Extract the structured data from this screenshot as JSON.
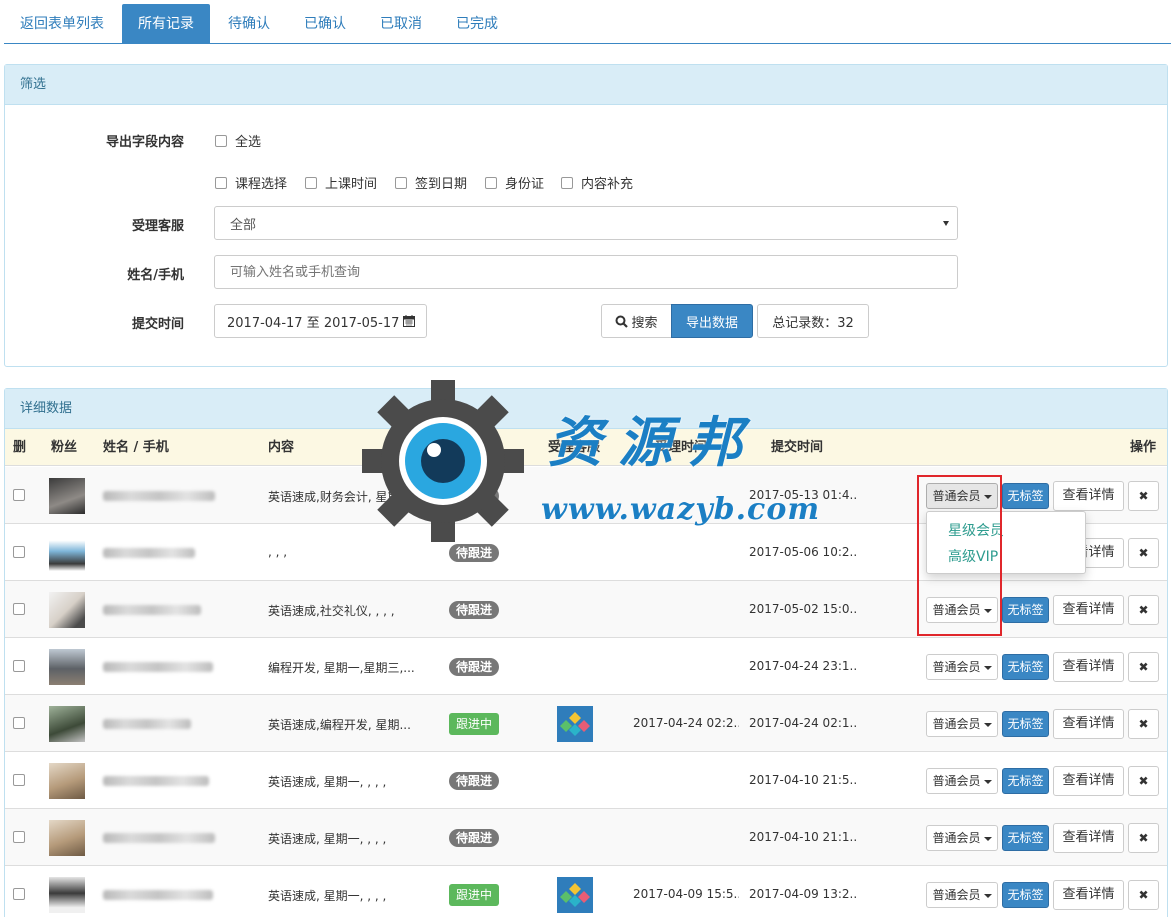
{
  "tabs": [
    "返回表单列表",
    "所有记录",
    "待确认",
    "已确认",
    "已取消",
    "已完成"
  ],
  "filter": {
    "title": "筛选",
    "export_label": "导出字段内容",
    "select_all": "全选",
    "fields": [
      "课程选择",
      "上课时间",
      "签到日期",
      "身份证",
      "内容补充"
    ],
    "service_label": "受理客服",
    "service_value": "全部",
    "name_label": "姓名/手机",
    "name_placeholder": "可输入姓名或手机查询",
    "time_label": "提交时间",
    "time_value": "2017-04-17 至 2017-05-17",
    "search_btn": "搜索",
    "export_btn": "导出数据",
    "total": "总记录数：32"
  },
  "detail": {
    "title": "详细数据",
    "headers": [
      "删",
      "粉丝",
      "姓名 / 手机",
      "内容",
      "状态",
      "受理客服",
      "受理时间",
      "提交时间",
      "操作"
    ],
    "rows": [
      {
        "content": "英语速成,财务会计, 星期",
        "status": "待跟进",
        "status_type": "gray",
        "accept_time": "",
        "submit_time": "2017-05-13 01:4...",
        "member": "普通会员",
        "tag": "无标签",
        "detail": "查看详情",
        "del": "✖"
      },
      {
        "content": ", , ,",
        "status": "待跟进",
        "status_type": "gray",
        "accept_time": "",
        "submit_time": "2017-05-06 10:2...",
        "member": "普通会员",
        "tag": "无标签",
        "detail": "查看详情",
        "del": "✖"
      },
      {
        "content": "英语速成,社交礼仪, , , ,",
        "status": "待跟进",
        "status_type": "gray",
        "accept_time": "",
        "submit_time": "2017-05-02 15:0...",
        "member": "普通会员",
        "tag": "无标签",
        "detail": "查看详情",
        "del": "✖"
      },
      {
        "content": "编程开发, 星期一,星期三,...",
        "status": "待跟进",
        "status_type": "gray",
        "accept_time": "",
        "submit_time": "2017-04-24 23:1...",
        "member": "普通会员",
        "tag": "无标签",
        "detail": "查看详情",
        "del": "✖"
      },
      {
        "content": "英语速成,编程开发, 星期...",
        "status": "跟进中",
        "status_type": "green",
        "accept_time": "2017-04-24 02:2...",
        "submit_time": "2017-04-24 02:1...",
        "member": "普通会员",
        "tag": "无标签",
        "detail": "查看详情",
        "del": "✖"
      },
      {
        "content": "英语速成, 星期一, , , ,",
        "status": "待跟进",
        "status_type": "gray",
        "accept_time": "",
        "submit_time": "2017-04-10 21:5...",
        "member": "普通会员",
        "tag": "无标签",
        "detail": "查看详情",
        "del": "✖"
      },
      {
        "content": "英语速成, 星期一, , , ,",
        "status": "待跟进",
        "status_type": "gray",
        "accept_time": "",
        "submit_time": "2017-04-10 21:1...",
        "member": "普通会员",
        "tag": "无标签",
        "detail": "查看详情",
        "del": "✖"
      },
      {
        "content": "英语速成, 星期一, , , ,",
        "status": "跟进中",
        "status_type": "green",
        "accept_time": "2017-04-09 15:5...",
        "submit_time": "2017-04-09 13:2...",
        "member": "普通会员",
        "tag": "无标签",
        "detail": "查看详情",
        "del": "✖"
      }
    ],
    "dropdown": [
      "星级会员",
      "高级VIP"
    ]
  },
  "watermark": {
    "title": "资源邦",
    "url": "www.wazyb.com"
  },
  "colors": {
    "primary": "#3a87c4",
    "panel_head": "#d9edf7",
    "table_head": "#fcf8e3",
    "green": "#5cb85c",
    "highlight": "#e0262b"
  }
}
